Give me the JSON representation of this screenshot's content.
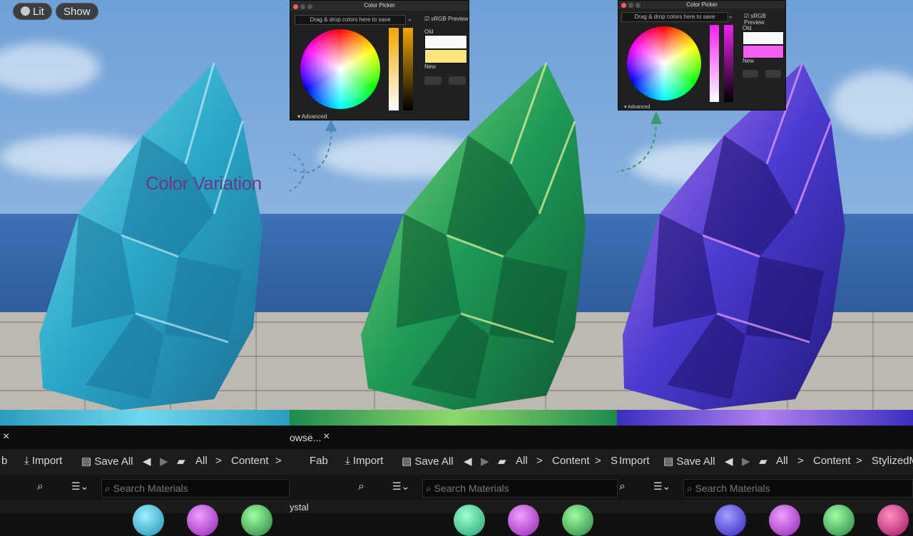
{
  "viewport": {
    "lit_label": "Lit",
    "show_label": "Show",
    "annotation": "Color Variation"
  },
  "pickers": [
    {
      "title": "Color Picker",
      "drop_text": "Drag & drop colors here to save",
      "srgb_label": "sRGB Preview",
      "old_label": "Old",
      "new_label": "New",
      "advanced_label": "Advanced",
      "new_color": "#fde57c"
    },
    {
      "title": "Color Picker",
      "drop_text": "Drag & drop colors here to save",
      "srgb_label": "sRGB Preview",
      "old_label": "Old",
      "new_label": "New",
      "advanced_label": "Advanced",
      "new_color": "#f05ff0"
    }
  ],
  "content_browser": {
    "tab_fragment": "owse...",
    "close_glyph": "×",
    "sections": [
      {
        "fab": "b",
        "import": "Import",
        "save_all": "Save All",
        "all": "All",
        "content": "Content",
        "sep": ">",
        "search_placeholder": "Search Materials"
      },
      {
        "fab": "Fab",
        "import": "Import",
        "save_all": "Save All",
        "all": "All",
        "content": "Content",
        "tail": "S",
        "sep": ">",
        "search_placeholder": "Search Materials",
        "folder_fragment": "ystal"
      },
      {
        "import": "Import",
        "save_all": "Save All",
        "all": "All",
        "content": "Content",
        "tail": "StylizedM",
        "sep": ">",
        "search_placeholder": "Search Materials"
      }
    ]
  },
  "colors": {
    "blue_rock": "#2aa6c8",
    "green_rock": "#1e9a58",
    "purple_rock": "#4a3ad0",
    "arrow": "#4a8ab8",
    "arrow_green": "#3a9a6a"
  }
}
